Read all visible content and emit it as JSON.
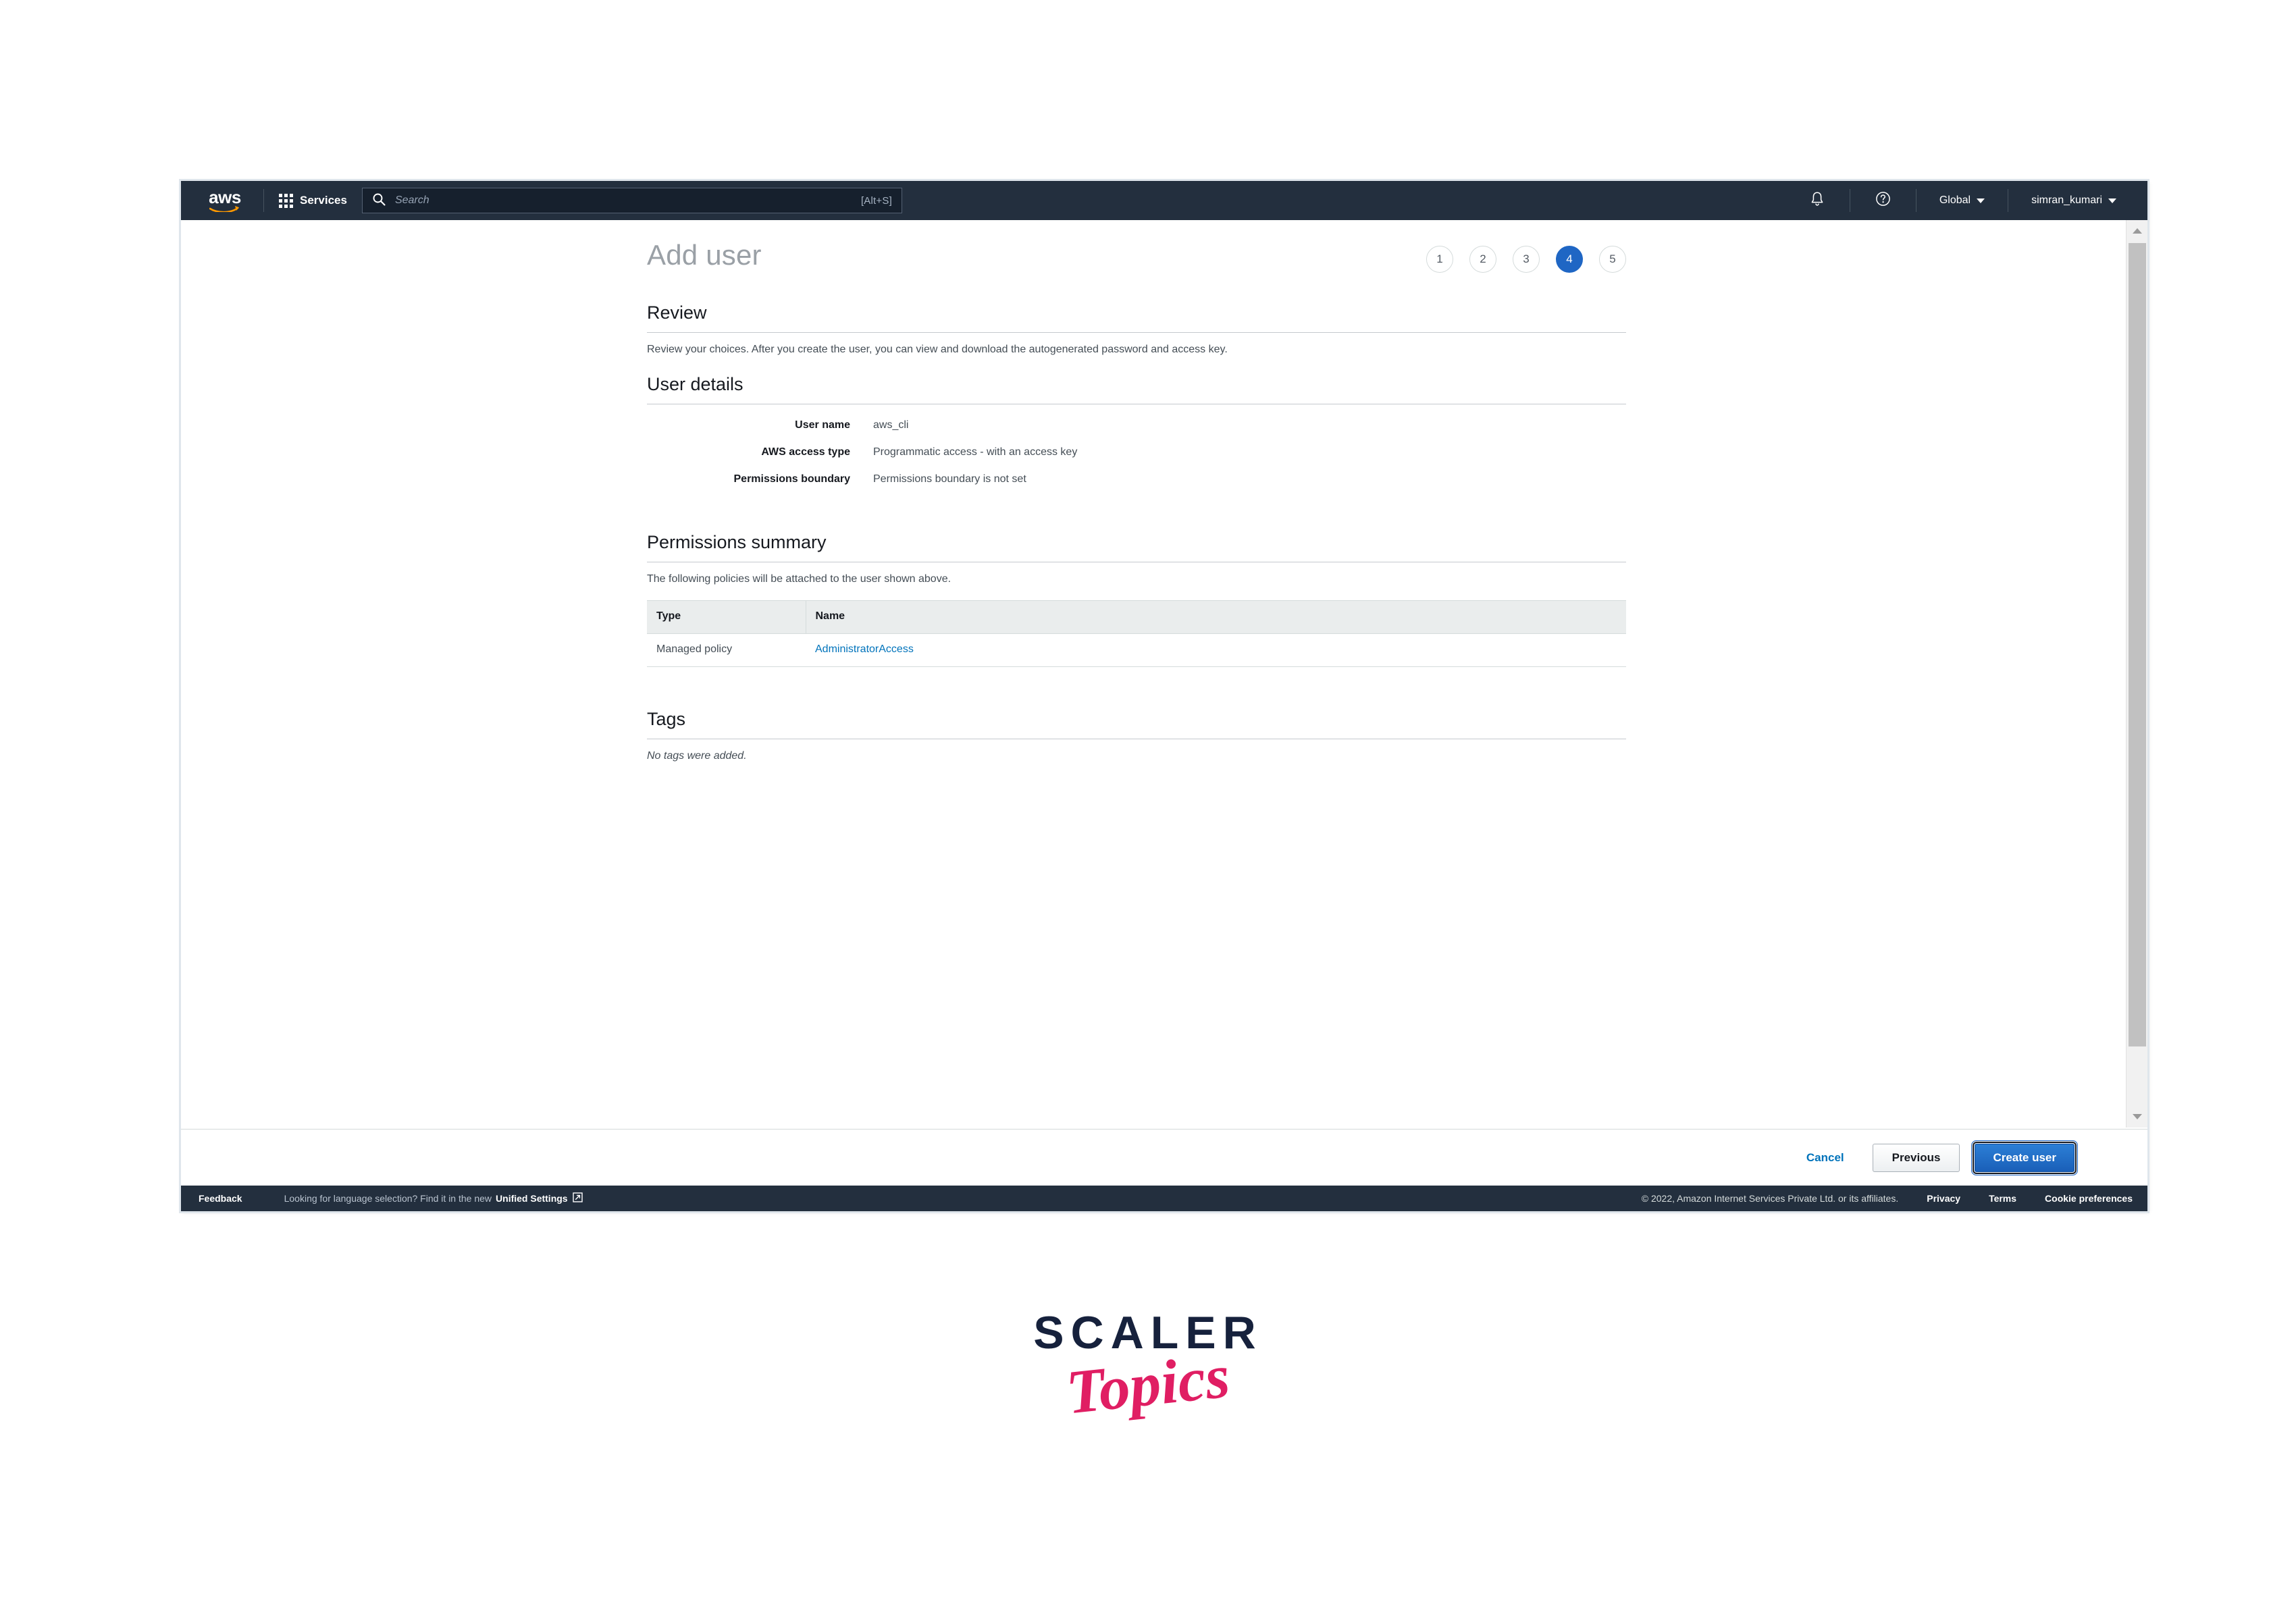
{
  "nav": {
    "logo_text": "aws",
    "logo_icon": "aws-smile-logo",
    "services_label": "Services",
    "services_icon": "grid-apps-icon",
    "search": {
      "placeholder": "Search",
      "value": "",
      "icon": "search-icon",
      "shortcut_hint": "[Alt+S]"
    },
    "notifications_icon": "bell-icon",
    "help_icon": "question-circle-icon",
    "region_label": "Global",
    "account_label": "simran_kumari"
  },
  "page": {
    "title": "Add user",
    "steps": [
      {
        "label": "1",
        "active": false
      },
      {
        "label": "2",
        "active": false
      },
      {
        "label": "3",
        "active": false
      },
      {
        "label": "4",
        "active": true
      },
      {
        "label": "5",
        "active": false
      }
    ]
  },
  "review": {
    "heading": "Review",
    "description": "Review your choices. After you create the user, you can view and download the autogenerated password and access key."
  },
  "user_details": {
    "heading": "User details",
    "rows": [
      {
        "label": "User name",
        "value": "aws_cli"
      },
      {
        "label": "AWS access type",
        "value": "Programmatic access - with an access key"
      },
      {
        "label": "Permissions boundary",
        "value": "Permissions boundary is not set"
      }
    ]
  },
  "permissions_summary": {
    "heading": "Permissions summary",
    "description": "The following policies will be attached to the user shown above.",
    "columns": [
      "Type",
      "Name"
    ],
    "rows": [
      {
        "type": "Managed policy",
        "name": "AdministratorAccess"
      }
    ]
  },
  "tags": {
    "heading": "Tags",
    "empty_text": "No tags were added."
  },
  "actions": {
    "cancel_label": "Cancel",
    "previous_label": "Previous",
    "create_label": "Create user"
  },
  "footer": {
    "feedback_label": "Feedback",
    "language_note": "Looking for language selection? Find it in the new",
    "unified_settings_label": "Unified Settings",
    "external_icon": "external-link-icon",
    "copyright": "© 2022, Amazon Internet Services Private Ltd. or its affiliates.",
    "privacy_label": "Privacy",
    "terms_label": "Terms",
    "cookie_label": "Cookie preferences"
  },
  "scrollbar": {
    "up_icon": "scroll-up-arrow-icon",
    "down_icon": "scroll-down-arrow-icon"
  },
  "watermark": {
    "brand": "SCALER",
    "sub": "Topics"
  },
  "colors": {
    "nav_bg": "#232f3e",
    "accent_blue": "#1f66c4",
    "link_blue": "#0073bb",
    "watermark_pink": "#e01e63",
    "watermark_navy": "#16213c"
  }
}
